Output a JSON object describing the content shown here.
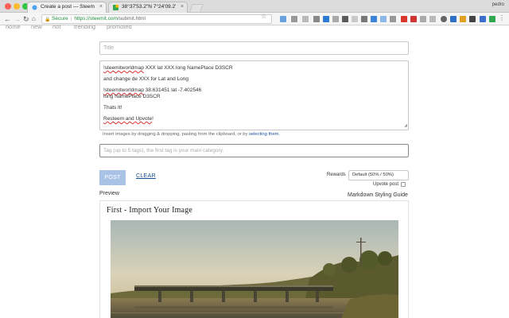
{
  "browser": {
    "tabs": [
      {
        "label": "Create a post — Steemit",
        "active": true
      },
      {
        "label": "38°37'53.2\"N 7°24'09.2\"W",
        "active": false
      }
    ],
    "profile": "pedro",
    "address": {
      "secure_label": "Secure",
      "url_host": "https://steemit.com",
      "url_path": "/submit.html"
    }
  },
  "site_nav": {
    "items": [
      "home",
      "new",
      "hot",
      "trending",
      "promoted"
    ]
  },
  "editor": {
    "title_placeholder": "Title",
    "body_lines": [
      [
        "!steemitworldmap",
        " XXX lat XXX long NamePlace D3SCR"
      ],
      [
        "and change de XXX for Lat and Long",
        ""
      ],
      [
        "!steemitworldmap",
        " 38.631451 lat -7.402546"
      ],
      [
        " long NamePlace D3SCR",
        ""
      ],
      [
        "Thats It!",
        ""
      ],
      [
        "Resteem and Upvote",
        "!"
      ]
    ],
    "drop_hint": "Insert images by dragging & dropping, pasting from the clipboard, or by ",
    "drop_hint_link": "selecting them.",
    "tags_placeholder": "Tag (up to 5 tags), the first tag is your main category."
  },
  "actions": {
    "post_label": "POST",
    "clear_label": "CLEAR",
    "rewards_label": "Rewards",
    "rewards_value": "Default (50% / 50%)",
    "upvote_label": "Upvote post"
  },
  "preview": {
    "label": "Preview",
    "guide_label": "Markdown Styling Guide",
    "post_title": "First - Import Your Image"
  },
  "colors": {
    "accent": "#1a5099",
    "post_button": "#a9c3e6"
  }
}
